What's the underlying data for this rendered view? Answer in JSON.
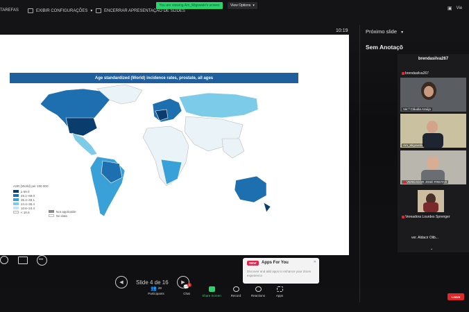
{
  "topbar": {
    "left_label": "TAREFAS",
    "settings_label": "EXIBIR CONFIGURAÇÕES",
    "end_label": "ENCERRAR APRESENTAÇÃO DE SLIDES",
    "banner": "You are viewing Arn_Migowski's screen",
    "view_options": "View Options",
    "right_label": "Vie"
  },
  "slide": {
    "title": "Age standardized (World) incidence rates, prostate, all ages",
    "legend_title": "ASR (World) per 100 000",
    "legend": [
      {
        "label": "≥ 69.0",
        "color": "#0b3c6e"
      },
      {
        "label": "49.1–69.0",
        "color": "#1d6fb0"
      },
      {
        "label": "35.4–49.1",
        "color": "#3aa0d8"
      },
      {
        "label": "24.4–35.4",
        "color": "#7ccbe8"
      },
      {
        "label": "10.6–24.4",
        "color": "#c5e3f0"
      },
      {
        "label": "< 10.6",
        "color": "#eaf4f8"
      }
    ],
    "na_legend": [
      {
        "label": "Not applicable",
        "color": "#8a8a8a"
      },
      {
        "label": "No data",
        "color": "#ffffff"
      }
    ]
  },
  "clock": "10:19",
  "right_panel": {
    "next_slide": "Próximo slide",
    "notes": "Sem Anotaçõ"
  },
  "gallery": {
    "header": "brendasilva267",
    "tiles": [
      {
        "top_name": "brendasilva267",
        "name": "Ver.ª Cláudia Araújo"
      },
      {
        "name": "Arn_Migowski"
      },
      {
        "name": "VEREADOR JOSÉ FREITAS"
      },
      {
        "name": "Vereadora Lourdes Sprenger"
      }
    ],
    "footer": "ver. Aldacir Olib..."
  },
  "slide_nav": {
    "label": "Slide 4 de 16"
  },
  "popup": {
    "badge": "NEW",
    "title": "Apps For You",
    "body": "Discover and add apps to enhance your Zoom experience"
  },
  "zoom_toolbar": {
    "participants_count": "28",
    "chat_badge": "1",
    "items": [
      "Participants",
      "Chat",
      "Share Screen",
      "Record",
      "Reactions",
      "Apps"
    ]
  },
  "leave": "Leave",
  "colors": {
    "share_green": "#2bd46b",
    "leave_red": "#e02828",
    "title_blue": "#1f5f9e"
  }
}
